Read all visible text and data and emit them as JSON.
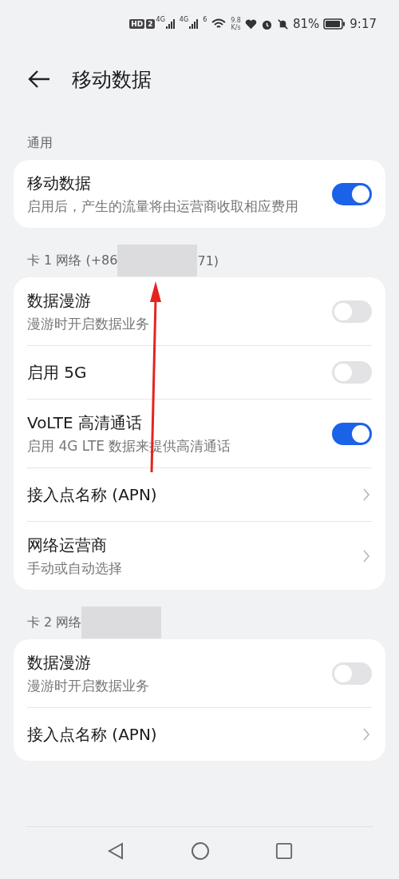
{
  "status_bar": {
    "hd": "HD",
    "sim": "2",
    "signal_labels": [
      "4G",
      "4G"
    ],
    "wifi_label": "6",
    "speed_value": "9.8",
    "speed_unit": "K/s",
    "battery": "81%",
    "time": "9:17"
  },
  "header": {
    "title": "移动数据"
  },
  "sections": [
    {
      "label": "通用",
      "redacted": false,
      "rows": [
        {
          "kind": "toggle",
          "title": "移动数据",
          "subtitle": "启用后，产生的流量将由运营商收取相应费用",
          "on": true
        }
      ]
    },
    {
      "label": "卡 1 网络 (+86",
      "redacted": true,
      "label_after": "71)",
      "rows": [
        {
          "kind": "toggle",
          "title": "数据漫游",
          "subtitle": "漫游时开启数据业务",
          "on": false
        },
        {
          "kind": "toggle",
          "title": "启用 5G",
          "on": false
        },
        {
          "kind": "toggle",
          "title": "VoLTE 高清通话",
          "subtitle": "启用 4G LTE 数据来提供高清通话",
          "on": true
        },
        {
          "kind": "link",
          "title": "接入点名称 (APN)"
        },
        {
          "kind": "link",
          "title": "网络运营商",
          "subtitle": "手动或自动选择"
        }
      ]
    },
    {
      "label": "卡 2 网络",
      "redacted": true,
      "rows": [
        {
          "kind": "toggle",
          "title": "数据漫游",
          "subtitle": "漫游时开启数据业务",
          "on": false
        },
        {
          "kind": "link",
          "title": "接入点名称 (APN)"
        }
      ]
    }
  ]
}
